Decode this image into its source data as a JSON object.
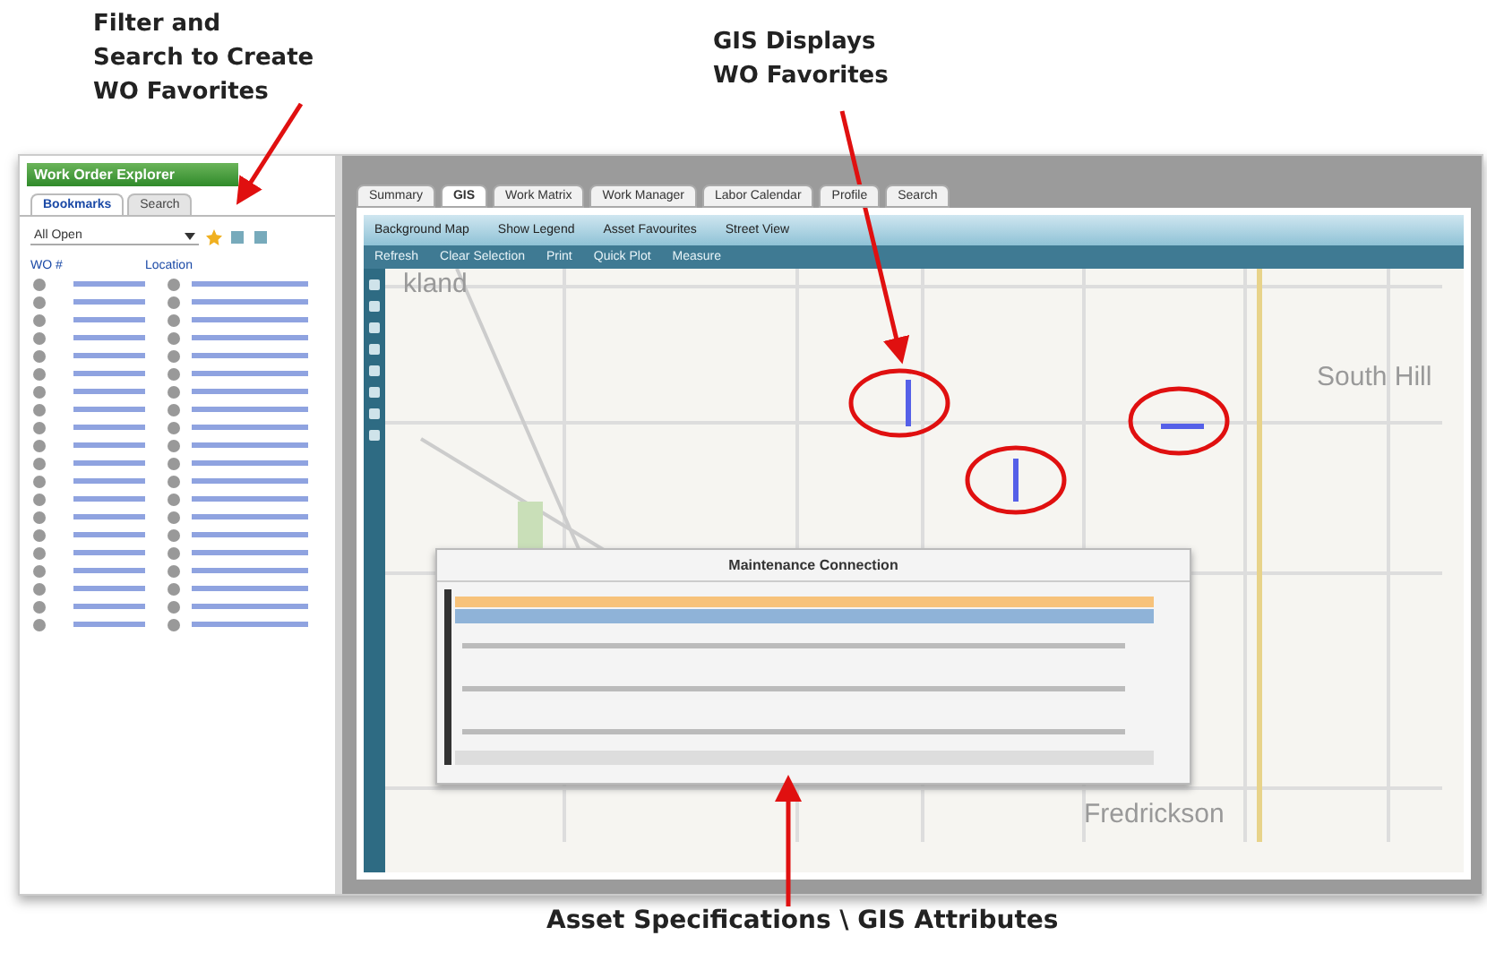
{
  "callouts": [
    {
      "kind": "top-left",
      "lines": [
        "Filter and",
        "Search to Create",
        "WO Favorites"
      ]
    },
    {
      "kind": "top-mid",
      "lines": [
        "GIS Displays",
        "WO Favorites"
      ]
    },
    {
      "kind": "bottom",
      "lines": [
        "Asset Specifications \\ GIS Attributes"
      ]
    }
  ],
  "explorer": {
    "title": "Work Order Explorer",
    "tabs": [
      {
        "label": "Bookmarks",
        "selected": true
      },
      {
        "label": "Search",
        "selected": false
      }
    ],
    "filter": "All Open",
    "columns": [
      "WO #",
      "Location"
    ]
  },
  "main": {
    "tabs": [
      {
        "label": "Summary",
        "selected": false
      },
      {
        "label": "GIS",
        "selected": true
      },
      {
        "label": "Work Matrix",
        "selected": false
      },
      {
        "label": "Work Manager",
        "selected": false
      },
      {
        "label": "Labor Calendar",
        "selected": false
      },
      {
        "label": "Profile",
        "selected": false
      },
      {
        "label": "Search",
        "selected": false
      }
    ],
    "map_menu": [
      "Background Map",
      "Show Legend",
      "Asset Favourites",
      "Street View"
    ],
    "map_tools": [
      "Refresh",
      "Clear Selection",
      "Print",
      "Quick Plot",
      "Measure"
    ],
    "map_labels": [
      "kland",
      "South Hill",
      "Fredrickson"
    ],
    "popup": {
      "title": "Maintenance Connection"
    }
  }
}
